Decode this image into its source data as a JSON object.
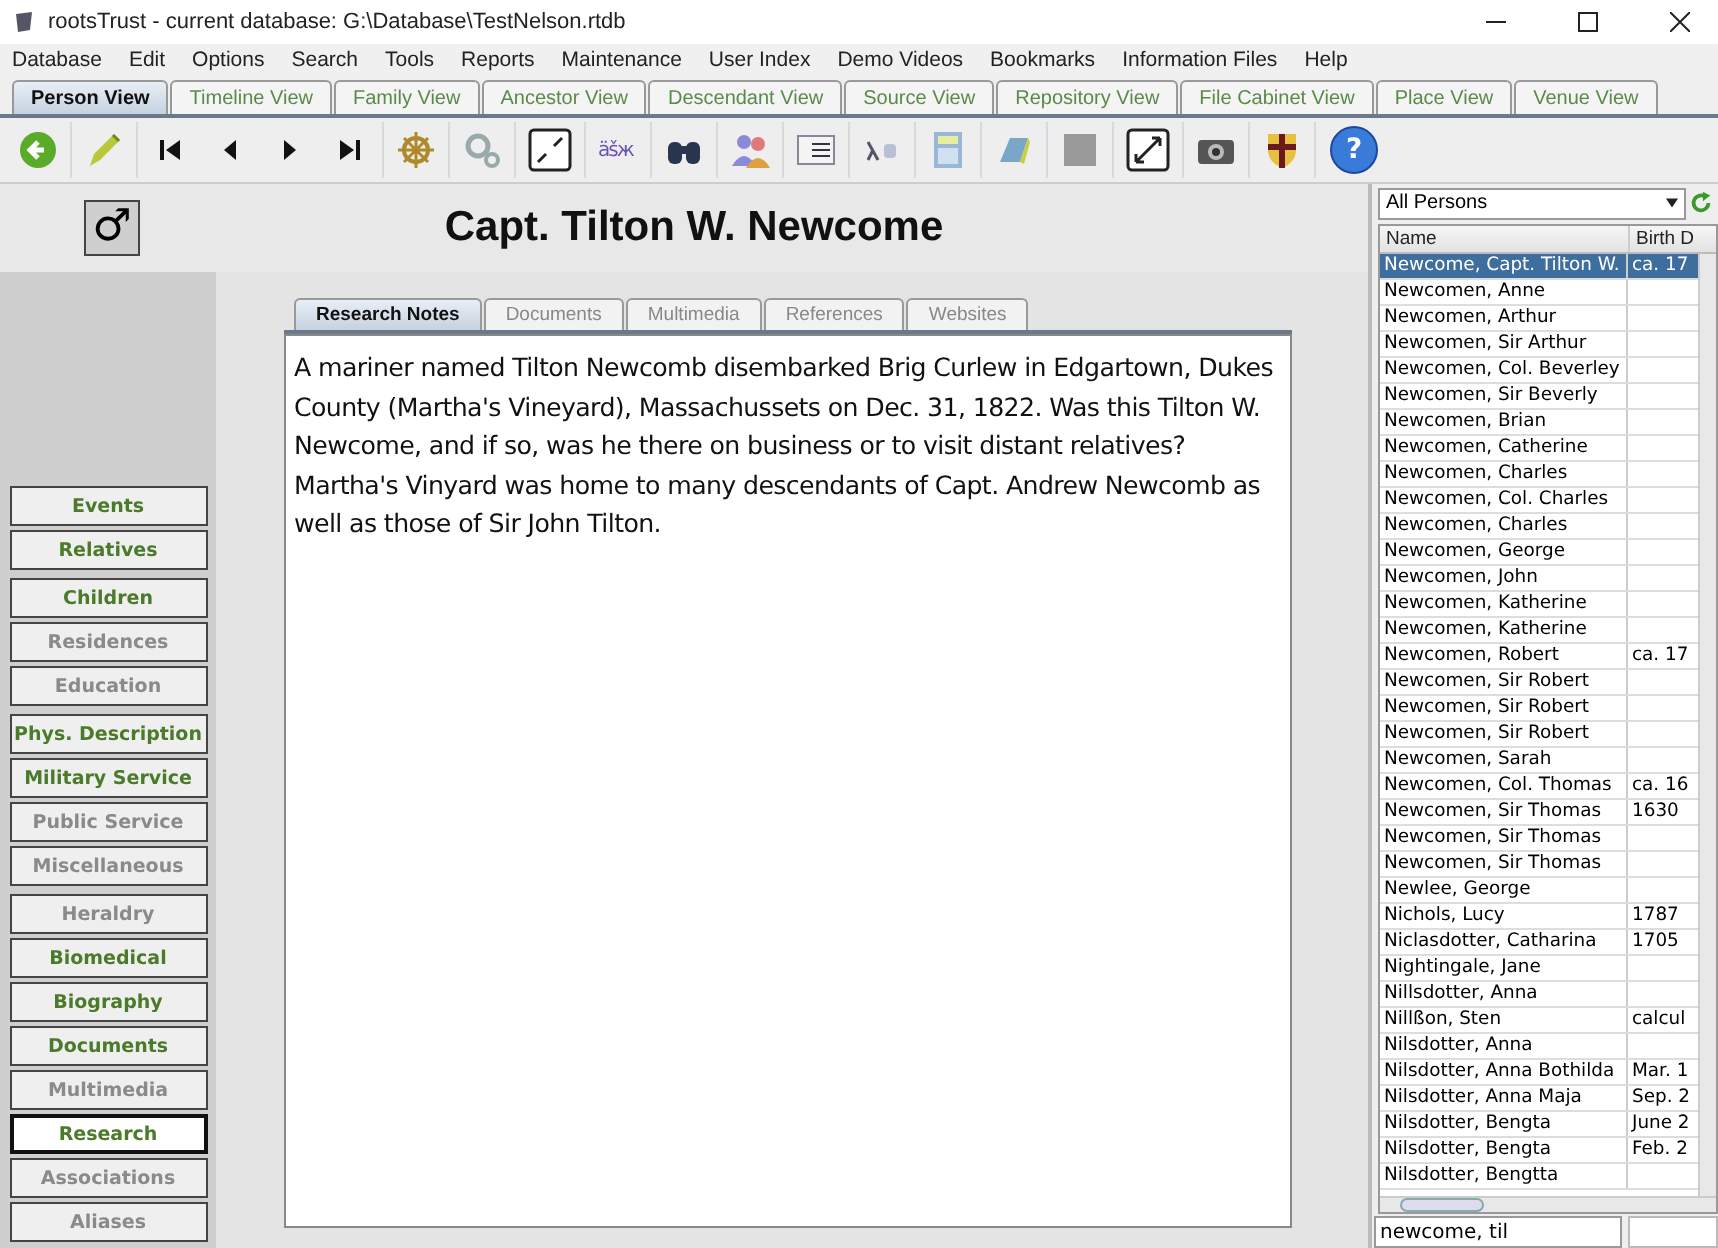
{
  "window": {
    "title": "rootsTrust - current database: G:\\Database\\TestNelson.rtdb"
  },
  "menu": [
    "Database",
    "Edit",
    "Options",
    "Search",
    "Tools",
    "Reports",
    "Maintenance",
    "User Index",
    "Demo Videos",
    "Bookmarks",
    "Information Files",
    "Help"
  ],
  "view_tabs": [
    {
      "label": "Person View",
      "selected": true
    },
    {
      "label": "Timeline View",
      "selected": false
    },
    {
      "label": "Family View",
      "selected": false
    },
    {
      "label": "Ancestor View",
      "selected": false
    },
    {
      "label": "Descendant View",
      "selected": false
    },
    {
      "label": "Source View",
      "selected": false
    },
    {
      "label": "Repository View",
      "selected": false
    },
    {
      "label": "File Cabinet View",
      "selected": false
    },
    {
      "label": "Place View",
      "selected": false
    },
    {
      "label": "Venue View",
      "selected": false
    }
  ],
  "toolbar": [
    {
      "kind": "back"
    },
    {
      "kind": "pencil"
    },
    {
      "kind": "first"
    },
    {
      "kind": "prev"
    },
    {
      "kind": "next"
    },
    {
      "kind": "last"
    },
    {
      "kind": "wheel"
    },
    {
      "kind": "gears"
    },
    {
      "kind": "shrink"
    },
    {
      "kind": "letters",
      "glyph": "äšж"
    },
    {
      "kind": "binoculars"
    },
    {
      "kind": "people"
    },
    {
      "kind": "list"
    },
    {
      "kind": "lambda"
    },
    {
      "kind": "calculator"
    },
    {
      "kind": "notepad"
    },
    {
      "kind": "grey"
    },
    {
      "kind": "expand"
    },
    {
      "kind": "camera"
    },
    {
      "kind": "shield"
    },
    {
      "kind": "help",
      "glyph": "?"
    }
  ],
  "person": {
    "sex_symbol": "♂",
    "name": "Capt. Tilton W. Newcome"
  },
  "sections": [
    {
      "label": "Events",
      "has_data": true,
      "selected": false
    },
    {
      "label": "Relatives",
      "has_data": true,
      "selected": false
    },
    {
      "label": "Children",
      "has_data": true,
      "selected": false
    },
    {
      "label": "Residences",
      "has_data": false,
      "selected": false
    },
    {
      "label": "Education",
      "has_data": false,
      "selected": false
    },
    {
      "label": "Phys. Description",
      "has_data": true,
      "selected": false
    },
    {
      "label": "Military Service",
      "has_data": true,
      "selected": false
    },
    {
      "label": "Public Service",
      "has_data": false,
      "selected": false
    },
    {
      "label": "Miscellaneous",
      "has_data": false,
      "selected": false
    },
    {
      "label": "Heraldry",
      "has_data": false,
      "selected": false
    },
    {
      "label": "Biomedical",
      "has_data": true,
      "selected": false
    },
    {
      "label": "Biography",
      "has_data": true,
      "selected": false
    },
    {
      "label": "Documents",
      "has_data": true,
      "selected": false
    },
    {
      "label": "Multimedia",
      "has_data": false,
      "selected": false
    },
    {
      "label": "Research",
      "has_data": true,
      "selected": true
    },
    {
      "label": "Associations",
      "has_data": false,
      "selected": false
    },
    {
      "label": "Aliases",
      "has_data": false,
      "selected": false
    }
  ],
  "detail_tabs": [
    {
      "label": "Research Notes",
      "selected": true
    },
    {
      "label": "Documents",
      "selected": false
    },
    {
      "label": "Multimedia",
      "selected": false
    },
    {
      "label": "References",
      "selected": false
    },
    {
      "label": "Websites",
      "selected": false
    }
  ],
  "notes": "A mariner named Tilton Newcomb disembarked Brig Curlew in Edgartown, Dukes County (Martha's Vineyard), Massachussets on Dec. 31, 1822. Was this Tilton W. Newcome, and if so, was he there on business or to visit distant relatives? Martha's Vinyard was home to many descendants of Capt. Andrew Newcomb as well as those of Sir John Tilton.",
  "person_list": {
    "filter": "All Persons",
    "columns": [
      "Name",
      "Birth D"
    ],
    "search": "newcome, til",
    "rows": [
      {
        "name": "Newcome, Capt. Tilton W.",
        "birth": "ca. 17",
        "selected": true
      },
      {
        "name": "Newcomen, Anne",
        "selected": false
      },
      {
        "name": "Newcomen, Arthur",
        "selected": false
      },
      {
        "name": "Newcomen, Sir Arthur",
        "selected": false
      },
      {
        "name": "Newcomen, Col. Beverley",
        "selected": false
      },
      {
        "name": "Newcomen, Sir Beverly",
        "selected": false
      },
      {
        "name": "Newcomen, Brian",
        "selected": false
      },
      {
        "name": "Newcomen, Catherine",
        "selected": false
      },
      {
        "name": "Newcomen, Charles",
        "selected": false
      },
      {
        "name": "Newcomen, Col. Charles",
        "selected": false
      },
      {
        "name": "Newcomen, Charles",
        "selected": false
      },
      {
        "name": "Newcomen, George",
        "selected": false
      },
      {
        "name": "Newcomen, John",
        "selected": false
      },
      {
        "name": "Newcomen, Katherine",
        "selected": false
      },
      {
        "name": "Newcomen, Katherine",
        "selected": false
      },
      {
        "name": "Newcomen, Robert",
        "birth": "ca. 17",
        "selected": false
      },
      {
        "name": "Newcomen, Sir Robert",
        "selected": false
      },
      {
        "name": "Newcomen, Sir Robert",
        "selected": false
      },
      {
        "name": "Newcomen, Sir Robert",
        "selected": false
      },
      {
        "name": "Newcomen, Sarah",
        "selected": false
      },
      {
        "name": "Newcomen, Col. Thomas",
        "birth": "ca. 16",
        "selected": false
      },
      {
        "name": "Newcomen, Sir Thomas",
        "birth": "1630",
        "selected": false
      },
      {
        "name": "Newcomen, Sir Thomas",
        "selected": false
      },
      {
        "name": "Newcomen, Sir Thomas",
        "selected": false
      },
      {
        "name": "Newlee, George",
        "selected": false
      },
      {
        "name": "Nichols, Lucy",
        "birth": "1787",
        "selected": false
      },
      {
        "name": "Niclasdotter, Catharina",
        "birth": "1705",
        "selected": false
      },
      {
        "name": "Nightingale, Jane",
        "selected": false
      },
      {
        "name": "Nillsdotter, Anna",
        "selected": false
      },
      {
        "name": "Nillßon, Sten",
        "birth": "calcul",
        "selected": false
      },
      {
        "name": "Nilsdotter, Anna",
        "selected": false
      },
      {
        "name": "Nilsdotter, Anna Bothilda",
        "birth": "Mar. 1",
        "selected": false
      },
      {
        "name": "Nilsdotter, Anna Maja",
        "birth": "Sep. 2",
        "selected": false
      },
      {
        "name": "Nilsdotter, Bengta",
        "birth": "June 2",
        "selected": false
      },
      {
        "name": "Nilsdotter, Bengta",
        "birth": "Feb. 2",
        "selected": false
      },
      {
        "name": "Nilsdotter, Bengtta",
        "selected": false
      }
    ]
  }
}
